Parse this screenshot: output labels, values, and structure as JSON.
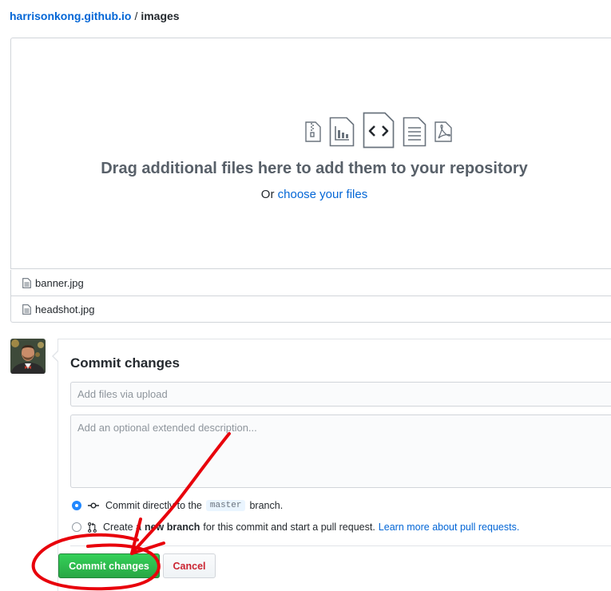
{
  "breadcrumb": {
    "repo": "harrisonkong.github.io",
    "separator": "/",
    "directory": "images"
  },
  "dropzone": {
    "title": "Drag additional files here to add them to your repository",
    "prefix": "Or",
    "link": "choose your files",
    "icons": [
      "file-zip-icon",
      "file-media-icon",
      "file-code-icon",
      "file-text-icon",
      "file-pdf-icon"
    ]
  },
  "files": [
    {
      "name": "banner.jpg",
      "icon": "file-icon"
    },
    {
      "name": "headshot.jpg",
      "icon": "file-icon"
    }
  ],
  "commit": {
    "title": "Commit changes",
    "summary_placeholder": "Add files via upload",
    "description_placeholder": "Add an optional extended description...",
    "option_direct": {
      "before": "Commit directly to the",
      "branch": "master",
      "after": "branch.",
      "selected": true
    },
    "option_new": {
      "before": "Create a",
      "strong": "new branch",
      "after": "for this commit and start a pull request.",
      "link": "Learn more about pull requests.",
      "selected": false
    },
    "submit_label": "Commit changes",
    "cancel_label": "Cancel"
  },
  "colors": {
    "link": "#0366d6",
    "primary_button": "#28a745",
    "cancel_text": "#cb2431",
    "radio_checked": "#2188ff",
    "annotation": "#e8000b"
  }
}
